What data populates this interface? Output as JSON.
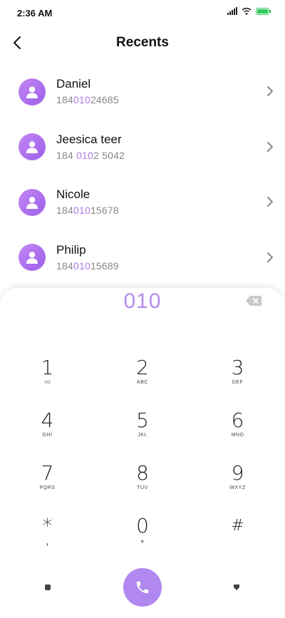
{
  "status": {
    "time": "2:36 AM",
    "battery_level": 1.0,
    "accent": "#34c759"
  },
  "header": {
    "title": "Recents",
    "back_icon": "chevron-left-icon"
  },
  "recents": [
    {
      "name": "Daniel",
      "number_pre": "184",
      "number_match": "010",
      "number_post": "24685"
    },
    {
      "name": "Jeesica teer",
      "number_pre": "184 ",
      "number_match": "010",
      "number_post": "2 5042"
    },
    {
      "name": "Nicole",
      "number_pre": "184",
      "number_match": "010",
      "number_post": "15678"
    },
    {
      "name": "Philip",
      "number_pre": "184",
      "number_match": "010",
      "number_post": "15689"
    }
  ],
  "dialer": {
    "input": "010",
    "accent": "#b088f0",
    "keys": [
      {
        "digit": "1",
        "letters": "ഠാ"
      },
      {
        "digit": "2",
        "letters": "ABC"
      },
      {
        "digit": "3",
        "letters": "DEF"
      },
      {
        "digit": "4",
        "letters": "GHI"
      },
      {
        "digit": "5",
        "letters": "JKL"
      },
      {
        "digit": "6",
        "letters": "MNO"
      },
      {
        "digit": "7",
        "letters": "PQRS"
      },
      {
        "digit": "8",
        "letters": "TUV"
      },
      {
        "digit": "9",
        "letters": "WXYZ"
      },
      {
        "digit": "*",
        "letters": ","
      },
      {
        "digit": "0",
        "letters": "+"
      },
      {
        "digit": "#",
        "letters": ""
      }
    ]
  }
}
